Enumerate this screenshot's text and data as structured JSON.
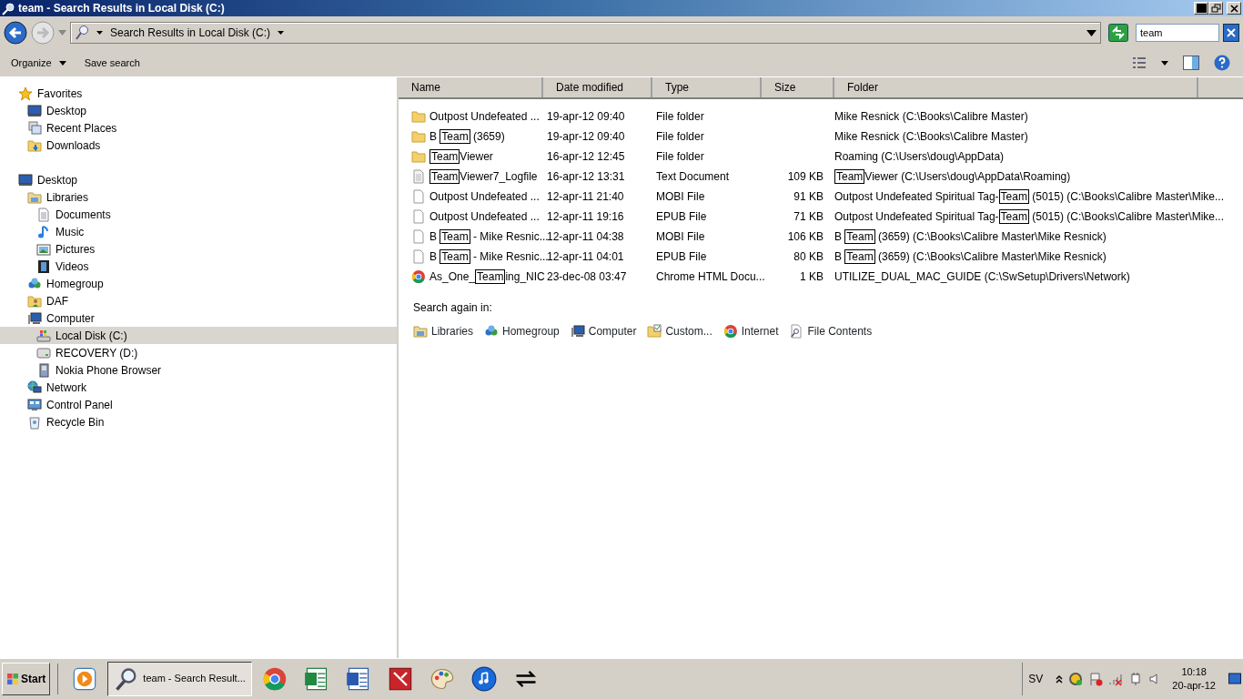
{
  "window": {
    "title": "team - Search Results in Local Disk (C:)"
  },
  "address_bar": {
    "path": "Search Results in Local Disk (C:)"
  },
  "search": {
    "value": "team"
  },
  "toolbar": {
    "buttons": [
      {
        "label": "Organize",
        "dropdown": true
      },
      {
        "label": "Save search",
        "dropdown": false
      }
    ]
  },
  "nav_tree": [
    {
      "label": "Favorites",
      "kind": "star",
      "selected": false,
      "children": [
        {
          "label": "Desktop",
          "kind": "desktop",
          "selected": false
        },
        {
          "label": "Recent Places",
          "kind": "recent",
          "selected": false
        },
        {
          "label": "Downloads",
          "kind": "downloads",
          "selected": false
        }
      ]
    },
    {
      "label": "Desktop",
      "kind": "desktop",
      "selected": false,
      "children": [
        {
          "label": "Libraries",
          "kind": "libraries",
          "selected": false,
          "children": [
            {
              "label": "Documents",
              "kind": "document",
              "selected": false
            },
            {
              "label": "Music",
              "kind": "music",
              "selected": false
            },
            {
              "label": "Pictures",
              "kind": "pictures",
              "selected": false
            },
            {
              "label": "Videos",
              "kind": "videos",
              "selected": false
            }
          ]
        },
        {
          "label": "Homegroup",
          "kind": "homegroup",
          "selected": false
        },
        {
          "label": "DAF",
          "kind": "user-folder",
          "selected": false
        },
        {
          "label": "Computer",
          "kind": "computer",
          "selected": false,
          "children": [
            {
              "label": "Local Disk (C:)",
              "kind": "system-drive",
              "selected": true
            },
            {
              "label": "RECOVERY (D:)",
              "kind": "drive",
              "selected": false
            },
            {
              "label": "Nokia Phone Browser",
              "kind": "phone",
              "selected": false
            }
          ]
        },
        {
          "label": "Network",
          "kind": "network",
          "selected": false
        },
        {
          "label": "Control Panel",
          "kind": "control-panel",
          "selected": false
        },
        {
          "label": "Recycle Bin",
          "kind": "recycle",
          "selected": false
        }
      ]
    }
  ],
  "columns": [
    "Name",
    "Date modified",
    "Type",
    "Size",
    "Folder"
  ],
  "rows": [
    {
      "kind": "folder",
      "name": [
        {
          "text": "Outpost Undefeated ...",
          "hit": false
        }
      ],
      "date": "19-apr-12 09:40",
      "type": "File folder",
      "folder": [
        {
          "text": "Mike Resnick (C:\\Books\\Calibre Master)",
          "hit": false
        }
      ]
    },
    {
      "kind": "folder",
      "name": [
        {
          "text": "B ",
          "hit": false
        },
        {
          "text": "Team",
          "hit": true
        },
        {
          "text": " (3659)",
          "hit": false
        }
      ],
      "date": "19-apr-12 09:40",
      "type": "File folder",
      "folder": [
        {
          "text": "Mike Resnick (C:\\Books\\Calibre Master)",
          "hit": false
        }
      ]
    },
    {
      "kind": "folder",
      "name": [
        {
          "text": "Team",
          "hit": true
        },
        {
          "text": "Viewer",
          "hit": false
        }
      ],
      "date": "16-apr-12 12:45",
      "type": "File folder",
      "folder": [
        {
          "text": "Roaming (C:\\Users\\doug\\AppData)",
          "hit": false
        }
      ]
    },
    {
      "kind": "text-file",
      "name": [
        {
          "text": "Team",
          "hit": true
        },
        {
          "text": "Viewer7_Logfile",
          "hit": false
        }
      ],
      "date": "16-apr-12 13:31",
      "type": "Text Document",
      "size": "109 KB",
      "folder": [
        {
          "text": "Team",
          "hit": true
        },
        {
          "text": "Viewer (C:\\Users\\doug\\AppData\\Roaming)",
          "hit": false
        }
      ]
    },
    {
      "kind": "file",
      "name": [
        {
          "text": "Outpost Undefeated ...",
          "hit": false
        }
      ],
      "date": "12-apr-11 21:40",
      "type": "MOBI File",
      "size": "91 KB",
      "folder": [
        {
          "text": "Outpost Undefeated Spiritual Tag-",
          "hit": false
        },
        {
          "text": "Team",
          "hit": true
        },
        {
          "text": " (5015) (C:\\Books\\Calibre Master\\Mike...",
          "hit": false
        }
      ]
    },
    {
      "kind": "file",
      "name": [
        {
          "text": "Outpost Undefeated ...",
          "hit": false
        }
      ],
      "date": "12-apr-11 19:16",
      "type": "EPUB File",
      "size": "71 KB",
      "folder": [
        {
          "text": "Outpost Undefeated Spiritual Tag-",
          "hit": false
        },
        {
          "text": "Team",
          "hit": true
        },
        {
          "text": " (5015) (C:\\Books\\Calibre Master\\Mike...",
          "hit": false
        }
      ]
    },
    {
      "kind": "file",
      "name": [
        {
          "text": "B ",
          "hit": false
        },
        {
          "text": "Team",
          "hit": true
        },
        {
          "text": " - Mike Resnic...",
          "hit": false
        }
      ],
      "date": "12-apr-11 04:38",
      "type": "MOBI File",
      "size": "106 KB",
      "folder": [
        {
          "text": "B ",
          "hit": false
        },
        {
          "text": "Team",
          "hit": true
        },
        {
          "text": " (3659) (C:\\Books\\Calibre Master\\Mike Resnick)",
          "hit": false
        }
      ]
    },
    {
      "kind": "file",
      "name": [
        {
          "text": "B ",
          "hit": false
        },
        {
          "text": "Team",
          "hit": true
        },
        {
          "text": " - Mike Resnic...",
          "hit": false
        }
      ],
      "date": "12-apr-11 04:01",
      "type": "EPUB File",
      "size": "80 KB",
      "folder": [
        {
          "text": "B ",
          "hit": false
        },
        {
          "text": "Team",
          "hit": true
        },
        {
          "text": " (3659) (C:\\Books\\Calibre Master\\Mike Resnick)",
          "hit": false
        }
      ]
    },
    {
      "kind": "chrome",
      "name": [
        {
          "text": "As_One_",
          "hit": false
        },
        {
          "text": "Team",
          "hit": true
        },
        {
          "text": "ing_NIC",
          "hit": false
        }
      ],
      "date": "23-dec-08 03:47",
      "type": "Chrome HTML Docu...",
      "size": "1 KB",
      "folder": [
        {
          "text": "UTILIZE_DUAL_MAC_GUIDE (C:\\SwSetup\\Drivers\\Network)",
          "hit": false
        }
      ]
    }
  ],
  "search_again": {
    "label": "Search again in:",
    "items": [
      {
        "label": "Libraries",
        "kind": "libraries"
      },
      {
        "label": "Homegroup",
        "kind": "homegroup"
      },
      {
        "label": "Computer",
        "kind": "computer"
      },
      {
        "label": "Custom...",
        "kind": "custom"
      },
      {
        "label": "Internet",
        "kind": "chrome"
      },
      {
        "label": "File Contents",
        "kind": "file-contents"
      }
    ]
  },
  "taskbar": {
    "start": "Start",
    "items": [
      {
        "kind": "media-player",
        "selected": false
      },
      {
        "kind": "search-window",
        "label": "team - Search Result...",
        "selected": true
      },
      {
        "kind": "chrome",
        "selected": false
      },
      {
        "kind": "spreadsheet",
        "selected": false
      },
      {
        "kind": "word-processor",
        "selected": false
      },
      {
        "kind": "red-app",
        "selected": false
      },
      {
        "kind": "paint",
        "selected": false
      },
      {
        "kind": "music-player",
        "selected": false
      },
      {
        "kind": "arrows",
        "selected": false
      }
    ],
    "language": "SV",
    "time": "10:18",
    "date": "20-apr-12"
  }
}
